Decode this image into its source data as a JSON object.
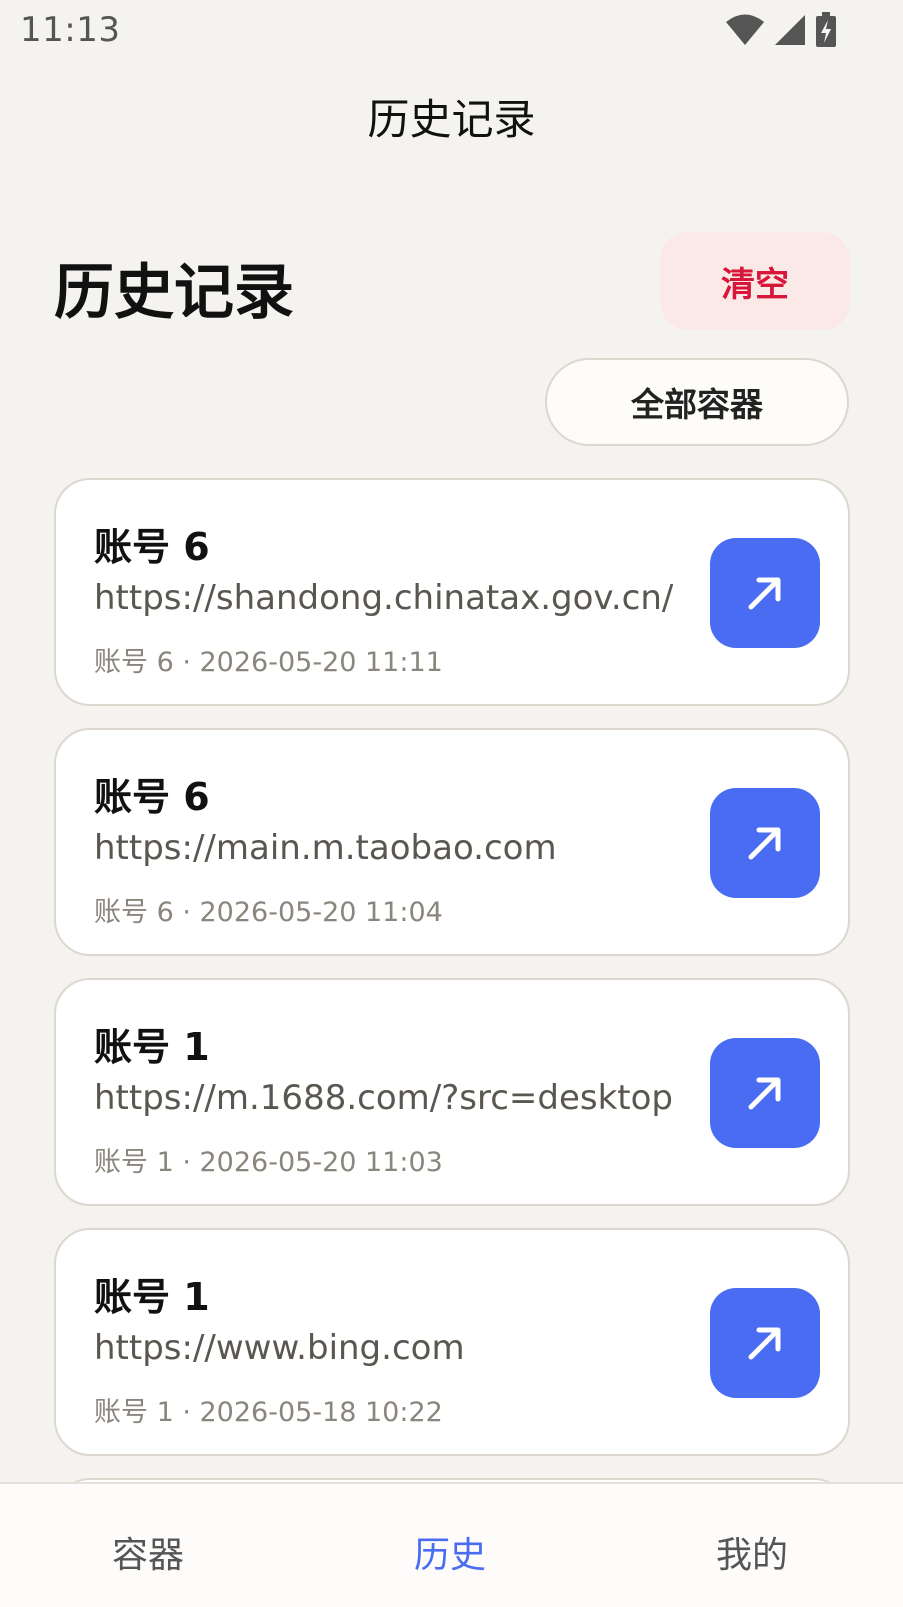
{
  "status_bar": {
    "time": "11:13"
  },
  "app_bar": {
    "title": "历史记录"
  },
  "header": {
    "title": "历史记录",
    "clear_label": "清空",
    "filter_label": "全部容器"
  },
  "history": [
    {
      "title": "账号 6",
      "url": "https://shandong.chinatax.gov.cn/",
      "meta": "账号 6 · 2026-05-20 11:11"
    },
    {
      "title": "账号 6",
      "url": "https://main.m.taobao.com",
      "meta": "账号 6 · 2026-05-20 11:04"
    },
    {
      "title": "账号 1",
      "url": "https://m.1688.com/?src=desktop",
      "meta": "账号 1 · 2026-05-20 11:03"
    },
    {
      "title": "账号 1",
      "url": "https://www.bing.com",
      "meta": "账号 1 · 2026-05-18 10:22"
    }
  ],
  "icons": {
    "open": "arrow-up-right-icon",
    "wifi": "wifi-icon",
    "signal": "signal-icon",
    "battery": "battery-charging-icon"
  },
  "bottom_nav": {
    "items": [
      {
        "label": "容器",
        "active": false
      },
      {
        "label": "历史",
        "active": true
      },
      {
        "label": "我的",
        "active": false
      }
    ]
  },
  "colors": {
    "accent": "#4a6cf2",
    "danger": "#d8163a",
    "danger_bg": "#fbe9e7",
    "background": "#f4f3ef"
  }
}
